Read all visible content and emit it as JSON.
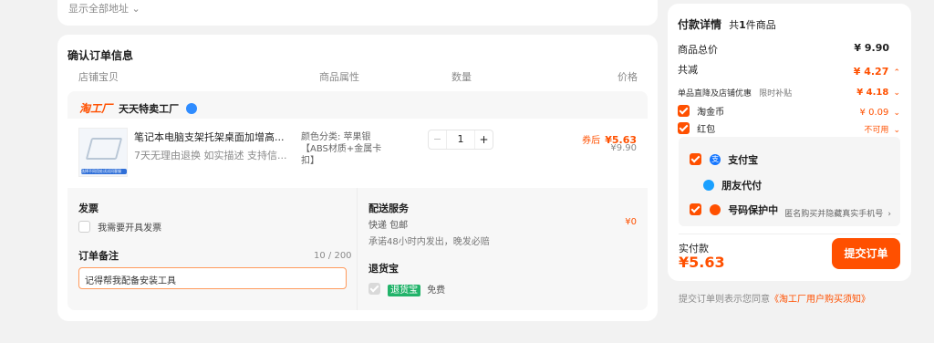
{
  "address": {
    "show_all": "显示全部地址 ⌄"
  },
  "order": {
    "title": "确认订单信息",
    "columns": [
      "店铺宝贝",
      "商品属性",
      "数量",
      "价格"
    ],
    "shop": {
      "brand": "淘工厂",
      "name": "天天特卖工厂"
    },
    "item": {
      "title": "笔记本电脑支架托架桌面加增高...",
      "subtitle": "7天无理由退换  如实描述  支持信...",
      "attr_line1": "颜色分类: 苹果银",
      "attr_line2": "【ABS材质+金属卡",
      "attr_line3": "扣】",
      "qty": "1",
      "minus": "−",
      "plus": "+",
      "coupon_label": "券后",
      "coupon_price": "¥5.63",
      "orig_price": "¥9.90",
      "thumb_tag": "选择不同用处试试问客服"
    },
    "invoice": {
      "title": "发票",
      "option": "我需要开具发票"
    },
    "note": {
      "title": "订单备注",
      "count": "10 / 200",
      "value": "记得帮我配备安装工具"
    },
    "delivery": {
      "title": "配送服务",
      "method": "快递 包邮",
      "promise": "承诺48小时内发出，晚发必赔",
      "fee": "¥0"
    },
    "returns": {
      "title": "退货宝",
      "badge": "退货宝",
      "free": "免费"
    }
  },
  "payment": {
    "title": "付款详情",
    "count_prefix": "共",
    "count_num": "1",
    "count_suffix": "件商品",
    "subtotal_label": "商品总价",
    "subtotal": "¥ 9.90",
    "discount_label": "共减",
    "discount": "¥ 4.27",
    "shop_discount_label": "单品直降及店铺优惠",
    "shop_discount_tag": "限时补贴",
    "shop_discount": "¥ 4.18",
    "coins_label": "淘金币",
    "coins": "¥ 0.09",
    "redpack_label": "红包",
    "redpack": "不可用",
    "methods": [
      {
        "label": "支付宝"
      },
      {
        "label": "朋友代付"
      },
      {
        "label": "号码保护中"
      }
    ],
    "privacy_hint": "匿名购买并隐藏真实手机号",
    "total_label": "实付款",
    "total": "¥5.63",
    "submit": "提交订单",
    "agree_prefix": "提交订单则表示您同意",
    "agree_link": "《淘工厂用户购买须知》"
  },
  "colors": {
    "accent": "#ff5000",
    "alipay": "#1677ff"
  }
}
